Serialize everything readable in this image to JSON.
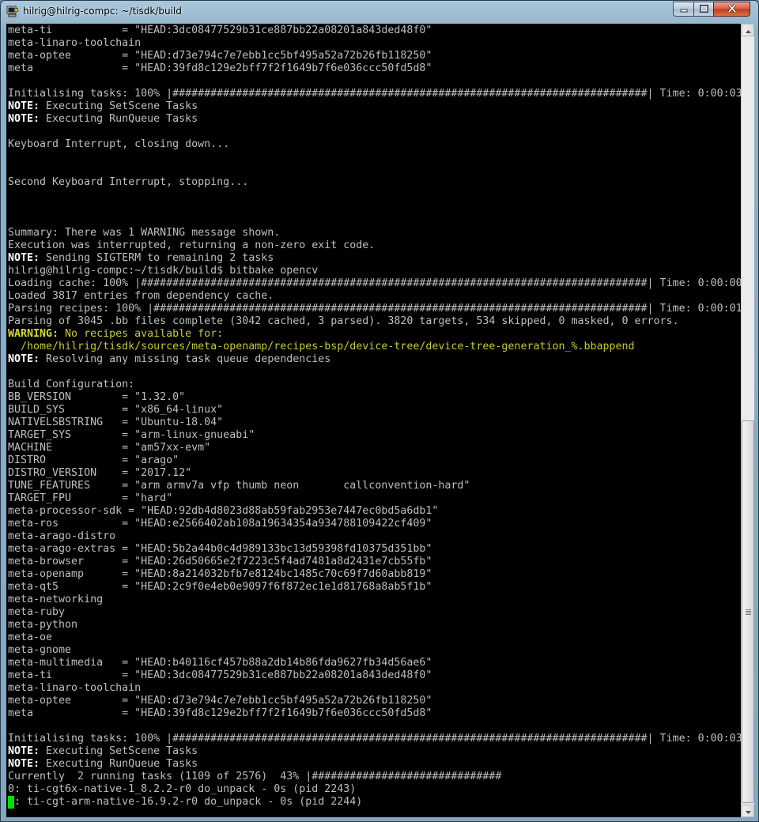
{
  "window": {
    "title": "hilrig@hilrig-compc: ~/tisdk/build",
    "icons": {
      "app": "putty-terminal-icon",
      "minimize": "minimize-icon",
      "maximize": "maximize-icon",
      "close": "close-icon"
    },
    "colors": {
      "terminal_bg": "#000000",
      "text": "#bfbfbf",
      "bold_text": "#ffffff",
      "warning": "#d9d936",
      "cursor": "#00e000",
      "close_button": "#c94a32"
    }
  },
  "terminal": {
    "lines": [
      [
        {
          "t": "meta-ti           = \"HEAD:3dc08477529b31ce887bb22a08201a843ded48f0\""
        }
      ],
      [
        {
          "t": "meta-linaro-toolchain"
        }
      ],
      [
        {
          "t": "meta-optee        = \"HEAD:d73e794c7e7ebb1cc5bf495a52a72b26fb118250\""
        }
      ],
      [
        {
          "t": "meta              = \"HEAD:39fd8c129e2bff7f2f1649b7f6e036ccc50fd5d8\""
        }
      ],
      [
        {
          "t": ""
        }
      ],
      [
        {
          "t": "Initialising tasks: 100% |###########################################################################| Time: 0:00:03"
        }
      ],
      [
        {
          "t": "NOTE:",
          "s": "bold"
        },
        {
          "t": " Executing SetScene Tasks"
        }
      ],
      [
        {
          "t": "NOTE:",
          "s": "bold"
        },
        {
          "t": " Executing RunQueue Tasks"
        }
      ],
      [
        {
          "t": ""
        }
      ],
      [
        {
          "t": "Keyboard Interrupt, closing down..."
        }
      ],
      [
        {
          "t": ""
        }
      ],
      [
        {
          "t": ""
        }
      ],
      [
        {
          "t": "Second Keyboard Interrupt, stopping..."
        }
      ],
      [
        {
          "t": ""
        }
      ],
      [
        {
          "t": ""
        }
      ],
      [
        {
          "t": ""
        }
      ],
      [
        {
          "t": "Summary: There was 1 WARNING message shown."
        }
      ],
      [
        {
          "t": "Execution was interrupted, returning a non-zero exit code."
        }
      ],
      [
        {
          "t": "NOTE:",
          "s": "bold"
        },
        {
          "t": " Sending SIGTERM to remaining 2 tasks"
        }
      ],
      [
        {
          "t": "hilrig@hilrig-compc:~/tisdk/build$ bitbake opencv"
        }
      ],
      [
        {
          "t": "Loading cache: 100% |################################################################################| Time: 0:00:00"
        }
      ],
      [
        {
          "t": "Loaded 3817 entries from dependency cache."
        }
      ],
      [
        {
          "t": "Parsing recipes: 100% |##############################################################################| Time: 0:00:01"
        }
      ],
      [
        {
          "t": "Parsing of 3045 .bb files complete (3042 cached, 3 parsed). 3820 targets, 534 skipped, 0 masked, 0 errors."
        }
      ],
      [
        {
          "t": "WARNING:",
          "s": "warn"
        },
        {
          "t": " No recipes available for:",
          "s": "yellow"
        }
      ],
      [
        {
          "t": "  /home/hilrig/tisdk/sources/meta-openamp/recipes-bsp/device-tree/device-tree-generation_%.bbappend",
          "s": "yellow"
        }
      ],
      [
        {
          "t": "NOTE:",
          "s": "bold"
        },
        {
          "t": " Resolving any missing task queue dependencies"
        }
      ],
      [
        {
          "t": ""
        }
      ],
      [
        {
          "t": "Build Configuration:"
        }
      ],
      [
        {
          "t": "BB_VERSION        = \"1.32.0\""
        }
      ],
      [
        {
          "t": "BUILD_SYS         = \"x86_64-linux\""
        }
      ],
      [
        {
          "t": "NATIVELSBSTRING   = \"Ubuntu-18.04\""
        }
      ],
      [
        {
          "t": "TARGET_SYS        = \"arm-linux-gnueabi\""
        }
      ],
      [
        {
          "t": "MACHINE           = \"am57xx-evm\""
        }
      ],
      [
        {
          "t": "DISTRO            = \"arago\""
        }
      ],
      [
        {
          "t": "DISTRO_VERSION    = \"2017.12\""
        }
      ],
      [
        {
          "t": "TUNE_FEATURES     = \"arm armv7a vfp thumb neon       callconvention-hard\""
        }
      ],
      [
        {
          "t": "TARGET_FPU        = \"hard\""
        }
      ],
      [
        {
          "t": "meta-processor-sdk = \"HEAD:92db4d8023d88ab59fab2953e7447ec0bd5a6db1\""
        }
      ],
      [
        {
          "t": "meta-ros          = \"HEAD:e2566402ab108a19634354a934788109422cf409\""
        }
      ],
      [
        {
          "t": "meta-arago-distro"
        }
      ],
      [
        {
          "t": "meta-arago-extras = \"HEAD:5b2a44b0c4d989133bc13d59398fd10375d351bb\""
        }
      ],
      [
        {
          "t": "meta-browser      = \"HEAD:26d50665e2f7223c5f4ad7481a8d2431e7cb55fb\""
        }
      ],
      [
        {
          "t": "meta-openamp      = \"HEAD:8a214032bfb7e8124bc1485c70c69f7d60abb819\""
        }
      ],
      [
        {
          "t": "meta-qt5          = \"HEAD:2c9f0e4eb0e9097f6f872ec1e1d81768a8ab5f1b\""
        }
      ],
      [
        {
          "t": "meta-networking"
        }
      ],
      [
        {
          "t": "meta-ruby"
        }
      ],
      [
        {
          "t": "meta-python"
        }
      ],
      [
        {
          "t": "meta-oe"
        }
      ],
      [
        {
          "t": "meta-gnome"
        }
      ],
      [
        {
          "t": "meta-multimedia   = \"HEAD:b40116cf457b88a2db14b86fda9627fb34d56ae6\""
        }
      ],
      [
        {
          "t": "meta-ti           = \"HEAD:3dc08477529b31ce887bb22a08201a843ded48f0\""
        }
      ],
      [
        {
          "t": "meta-linaro-toolchain"
        }
      ],
      [
        {
          "t": "meta-optee        = \"HEAD:d73e794c7e7ebb1cc5bf495a52a72b26fb118250\""
        }
      ],
      [
        {
          "t": "meta              = \"HEAD:39fd8c129e2bff7f2f1649b7f6e036ccc50fd5d8\""
        }
      ],
      [
        {
          "t": ""
        }
      ],
      [
        {
          "t": "Initialising tasks: 100% |###########################################################################| Time: 0:00:03"
        }
      ],
      [
        {
          "t": "NOTE:",
          "s": "bold"
        },
        {
          "t": " Executing SetScene Tasks"
        }
      ],
      [
        {
          "t": "NOTE:",
          "s": "bold"
        },
        {
          "t": " Executing RunQueue Tasks"
        }
      ],
      [
        {
          "t": "Currently  2 running tasks (1109 of 2576)  43% |##############################                                         |"
        }
      ],
      [
        {
          "t": "0: ti-cgt6x-native-1_8.2.2-r0 do_unpack - 0s (pid 2243)"
        }
      ],
      [
        {
          "t": "1: ti-cgt-arm-native-16.9.2-r0 do_unpack - 0s (pid 2244)"
        }
      ]
    ]
  }
}
